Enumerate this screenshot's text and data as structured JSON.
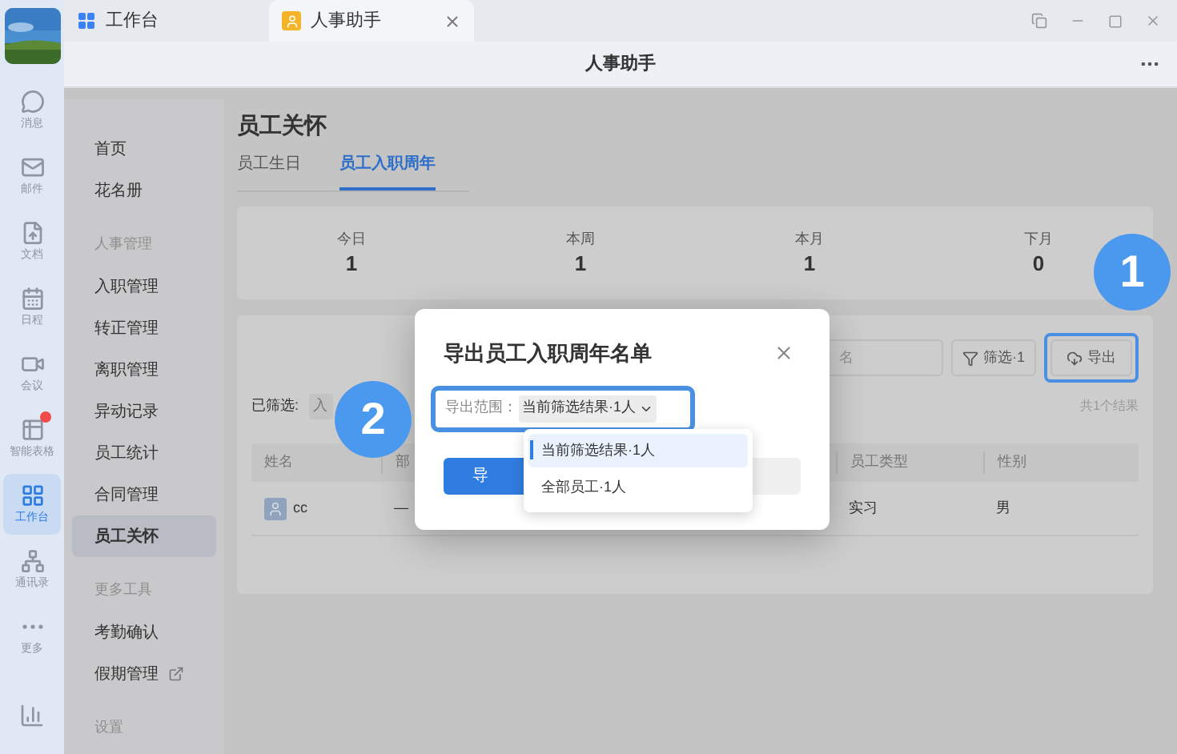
{
  "tabs": [
    {
      "label": "工作台",
      "selected": false,
      "closable": false
    },
    {
      "label": "人事助手",
      "selected": true,
      "closable": true
    }
  ],
  "header": {
    "title": "人事助手"
  },
  "rail": {
    "items": [
      {
        "label": "消息",
        "kind": "message",
        "selected": false,
        "notification": false
      },
      {
        "label": "邮件",
        "kind": "mail",
        "selected": false,
        "notification": false
      },
      {
        "label": "文档",
        "kind": "doc",
        "selected": false,
        "notification": false
      },
      {
        "label": "日程",
        "kind": "calendar",
        "selected": false,
        "notification": false
      },
      {
        "label": "会议",
        "kind": "meeting",
        "selected": false,
        "notification": false
      },
      {
        "label": "智能表格",
        "kind": "sheet",
        "selected": false,
        "notification": true
      },
      {
        "label": "工作台",
        "kind": "workbench",
        "selected": true,
        "notification": false
      },
      {
        "label": "通讯录",
        "kind": "contacts",
        "selected": false,
        "notification": false
      },
      {
        "label": "更多",
        "kind": "more",
        "selected": false,
        "notification": false
      }
    ]
  },
  "sidebar": {
    "items": [
      {
        "label": "首页",
        "kind": "item",
        "selected": false,
        "external": false
      },
      {
        "label": "花名册",
        "kind": "item",
        "selected": false,
        "external": false
      },
      {
        "label": "人事管理",
        "kind": "section"
      },
      {
        "label": "入职管理",
        "kind": "item",
        "selected": false,
        "external": false
      },
      {
        "label": "转正管理",
        "kind": "item",
        "selected": false,
        "external": false
      },
      {
        "label": "离职管理",
        "kind": "item",
        "selected": false,
        "external": false
      },
      {
        "label": "异动记录",
        "kind": "item",
        "selected": false,
        "external": false
      },
      {
        "label": "员工统计",
        "kind": "item",
        "selected": false,
        "external": false
      },
      {
        "label": "合同管理",
        "kind": "item",
        "selected": false,
        "external": false
      },
      {
        "label": "员工关怀",
        "kind": "item",
        "selected": true,
        "external": false
      },
      {
        "label": "更多工具",
        "kind": "section"
      },
      {
        "label": "考勤确认",
        "kind": "item",
        "selected": false,
        "external": false
      },
      {
        "label": "假期管理",
        "kind": "item",
        "selected": false,
        "external": true
      },
      {
        "label": "设置",
        "kind": "section"
      }
    ]
  },
  "page": {
    "title": "员工关怀",
    "tabs": [
      {
        "label": "员工生日",
        "selected": false
      },
      {
        "label": "员工入职周年",
        "selected": true
      }
    ]
  },
  "stats": [
    {
      "label": "今日",
      "value": "1"
    },
    {
      "label": "本周",
      "value": "1"
    },
    {
      "label": "本月",
      "value": "1"
    },
    {
      "label": "下月",
      "value": "0"
    }
  ],
  "list": {
    "search": {
      "placeholder": "名"
    },
    "filter_button": "筛选·1",
    "export_button": "导出",
    "filtered_label": "已筛选:",
    "filter_chips": [
      "入"
    ],
    "result_count": "共1个结果",
    "columns": [
      "姓名",
      "部",
      "员工类型",
      "性别"
    ],
    "rows": [
      {
        "cells": [
          "cc",
          "—",
          "实习",
          "男"
        ]
      }
    ]
  },
  "modal": {
    "title": "导出员工入职周年名单",
    "range_label": "导出范围：",
    "range_value": "当前筛选结果·1人",
    "primary_button": "导",
    "options": [
      {
        "label": "当前筛选结果·1人",
        "selected": true
      },
      {
        "label": "全部员工·1人",
        "selected": false
      }
    ]
  },
  "annotations": [
    {
      "label": "1"
    },
    {
      "label": "2"
    }
  ]
}
